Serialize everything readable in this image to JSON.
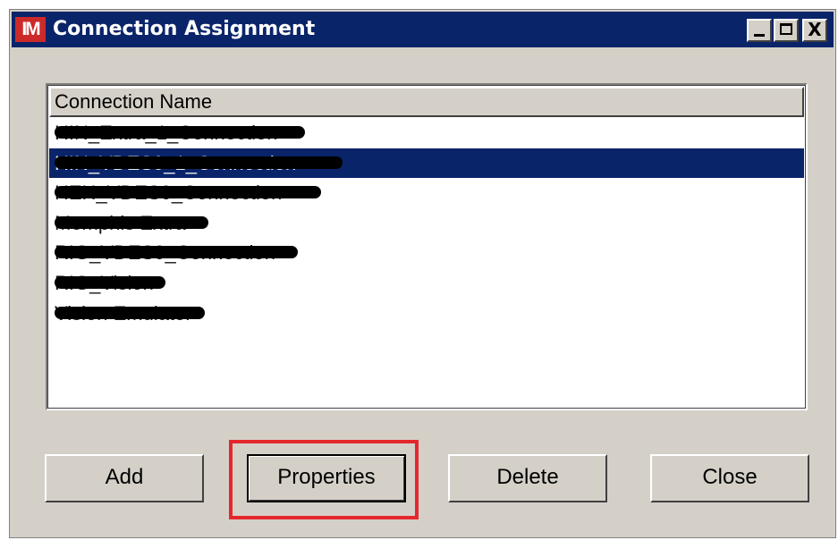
{
  "window": {
    "app_icon_text": "IM",
    "title": "Connection Assignment",
    "controls": {
      "minimize": "minimize-icon",
      "maximize": "maximize-icon",
      "close": "close-icon",
      "close_glyph": "X"
    }
  },
  "list": {
    "column_header": "Connection Name",
    "rows": [
      {
        "label": "HIN_Extra_1_Connection",
        "selected": false
      },
      {
        "label": "HIN_VDES0_1_Connection",
        "selected": true
      },
      {
        "label": "HEH_VDES0_Connection",
        "selected": false
      },
      {
        "label": "Memphis Extra",
        "selected": false
      },
      {
        "label": "RIG_VDES0_Connection",
        "selected": false
      },
      {
        "label": "RIG_Vision",
        "selected": false
      },
      {
        "label": "Vision Emulator",
        "selected": false
      }
    ]
  },
  "buttons": {
    "add": "Add",
    "properties": "Properties",
    "delete": "Delete",
    "close": "Close"
  },
  "colors": {
    "titlebar": "#0a246a",
    "selection": "#0a246a",
    "highlight_box": "#e5272d"
  }
}
